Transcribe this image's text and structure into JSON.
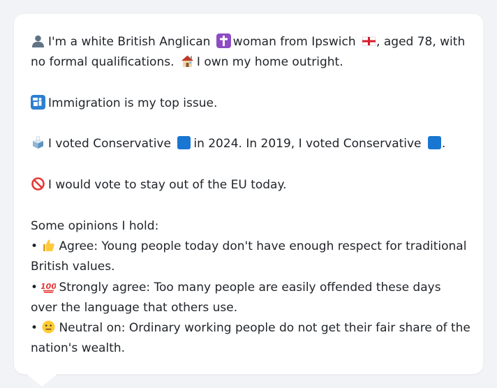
{
  "profile": {
    "line1_before": "I'm a white British Anglican",
    "line1_middle": "woman from Ipswich",
    "line1_after": ", aged 78, with no formal qualifications.",
    "home_text": "I own my home outright.",
    "issue_text": "Immigration is my top issue.",
    "vote_2024": "I voted Conservative",
    "vote_mid": "in 2024. In 2019, I voted Conservative",
    "vote_end": ".",
    "eu_text": "I would vote to stay out of the EU today.",
    "opinions_header": "Some opinions I hold:",
    "opinions": [
      {
        "bullet": "•",
        "text": "Agree: Young people today don't have enough respect for traditional British values."
      },
      {
        "bullet": "•",
        "text": "Strongly agree: Too many people are easily offended these days over the language that others use."
      },
      {
        "bullet": "•",
        "text": "Neutral on: Ordinary working people do not get their fair share of the nation's wealth."
      }
    ]
  },
  "icons": {
    "person": "person-silhouette-icon",
    "cross": "latin-cross-icon",
    "flag": "england-flag-icon",
    "house": "house-icon",
    "immigration": "passport-control-icon",
    "ballot": "ballot-box-icon",
    "party_square": "blue-square-icon",
    "no_entry": "prohibited-icon",
    "thumbs_up": "thumbs-up-icon",
    "hundred": "hundred-points-icon",
    "neutral": "neutral-face-icon"
  },
  "colors": {
    "background": "#f1f3f6",
    "card": "#ffffff",
    "text": "#1f2328",
    "conservative_blue": "#1976d2"
  }
}
